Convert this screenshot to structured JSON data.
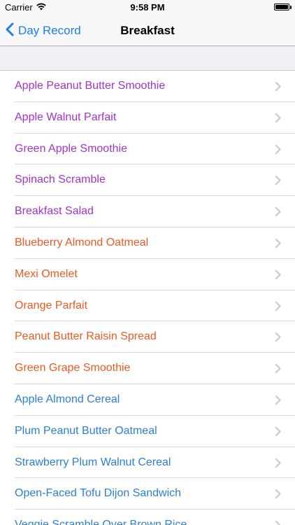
{
  "status_bar": {
    "carrier": "Carrier",
    "time": "9:58 PM",
    "wifi_icon": "wifi-icon",
    "battery_icon": "battery-icon"
  },
  "nav": {
    "back_label": "Day Record",
    "title": "Breakfast"
  },
  "colors": {
    "accent": "#1a7ef7",
    "purple": "#a332c7",
    "orange": "#ec5a22",
    "blue": "#2b7fd6",
    "chevron": "#c7c7cc"
  },
  "items": [
    {
      "label": "Apple Peanut Butter Smoothie",
      "color": "#a332c7"
    },
    {
      "label": "Apple Walnut Parfait",
      "color": "#a332c7"
    },
    {
      "label": "Green Apple Smoothie",
      "color": "#a332c7"
    },
    {
      "label": "Spinach Scramble",
      "color": "#a332c7"
    },
    {
      "label": "Breakfast Salad",
      "color": "#a332c7"
    },
    {
      "label": "Blueberry Almond Oatmeal",
      "color": "#ec5a22"
    },
    {
      "label": "Mexi Omelet",
      "color": "#ec5a22"
    },
    {
      "label": "Orange Parfait",
      "color": "#ec5a22"
    },
    {
      "label": "Peanut Butter Raisin Spread",
      "color": "#ec5a22"
    },
    {
      "label": "Green Grape Smoothie",
      "color": "#ec5a22"
    },
    {
      "label": "Apple Almond Cereal",
      "color": "#2b7fd6"
    },
    {
      "label": "Plum Peanut Butter Oatmeal",
      "color": "#2b7fd6"
    },
    {
      "label": "Strawberry Plum Walnut Cereal",
      "color": "#2b7fd6"
    },
    {
      "label": "Open-Faced Tofu Dijon Sandwich",
      "color": "#2b7fd6"
    },
    {
      "label": "Veggie Scramble Over Brown Rice",
      "color": "#2b7fd6"
    }
  ]
}
